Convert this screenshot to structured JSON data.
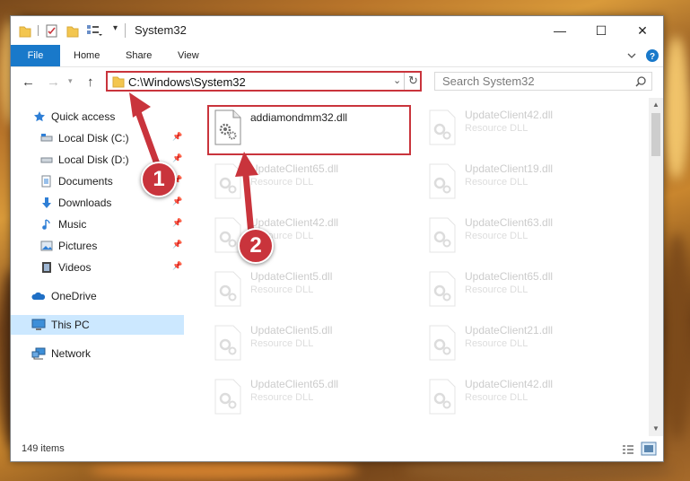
{
  "window": {
    "title": "System32",
    "status_count": "149 items"
  },
  "ribbon": {
    "tabs": [
      "File",
      "Home",
      "Share",
      "View"
    ]
  },
  "address": {
    "path": "C:\\Windows\\System32"
  },
  "search": {
    "placeholder": "Search System32"
  },
  "sidebar": {
    "items": [
      {
        "label": "Quick access",
        "icon": "star-icon",
        "pinned": false
      },
      {
        "label": "Local Disk (C:)",
        "icon": "drive-icon",
        "pinned": true
      },
      {
        "label": "Local Disk (D:)",
        "icon": "drive-icon",
        "pinned": true
      },
      {
        "label": "Documents",
        "icon": "documents-icon",
        "pinned": true
      },
      {
        "label": "Downloads",
        "icon": "download-icon",
        "pinned": true
      },
      {
        "label": "Music",
        "icon": "music-icon",
        "pinned": true
      },
      {
        "label": "Pictures",
        "icon": "pictures-icon",
        "pinned": true
      },
      {
        "label": "Videos",
        "icon": "videos-icon",
        "pinned": true
      },
      {
        "label": "OneDrive",
        "icon": "cloud-icon",
        "pinned": false
      },
      {
        "label": "This PC",
        "icon": "computer-icon",
        "pinned": false,
        "selected": true
      },
      {
        "label": "Network",
        "icon": "network-icon",
        "pinned": false
      }
    ]
  },
  "files": [
    {
      "name": "addiamondmm32.dll",
      "type": "",
      "highlighted": true
    },
    {
      "name": "UpdateClient42.dll",
      "type": "Resource DLL"
    },
    {
      "name": "UpdateClient65.dll",
      "type": "Resource DLL"
    },
    {
      "name": "UpdateClient19.dll",
      "type": "Resource DLL"
    },
    {
      "name": "UpdateClient42.dll",
      "type": "Resource DLL"
    },
    {
      "name": "UpdateClient63.dll",
      "type": "Resource DLL"
    },
    {
      "name": "UpdateClient5.dll",
      "type": "Resource DLL"
    },
    {
      "name": "UpdateClient65.dll",
      "type": "Resource DLL"
    },
    {
      "name": "UpdateClient5.dll",
      "type": "Resource DLL"
    },
    {
      "name": "UpdateClient21.dll",
      "type": "Resource DLL"
    },
    {
      "name": "UpdateClient65.dll",
      "type": "Resource DLL"
    },
    {
      "name": "UpdateClient42.dll",
      "type": "Resource DLL"
    }
  ],
  "callouts": {
    "step1": "1",
    "step2": "2"
  },
  "colors": {
    "accent": "#1979ca",
    "highlight": "#c9343c",
    "selected": "#cce8ff"
  }
}
